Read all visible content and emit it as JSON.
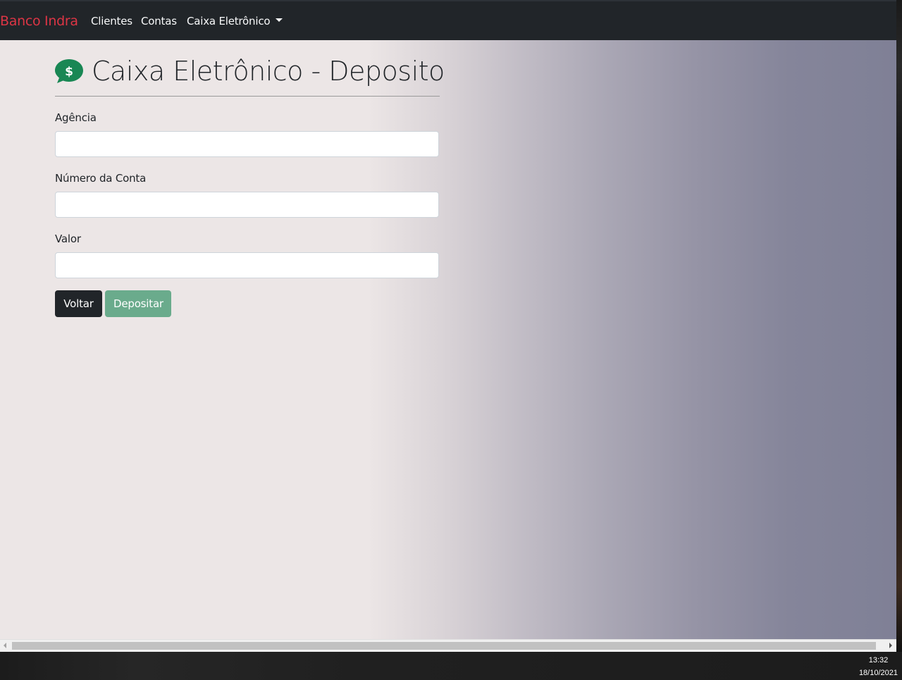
{
  "navbar": {
    "brand": "Banco Indra",
    "links": [
      "Clientes",
      "Contas",
      "Caixa Eletrônico"
    ]
  },
  "page": {
    "title": "Caixa Eletrônico - Deposito",
    "icon": "money-bubble-icon",
    "icon_color": "#198754"
  },
  "form": {
    "agencia_label": "Agência",
    "agencia_value": "",
    "conta_label": "Número da Conta",
    "conta_value": "",
    "valor_label": "Valor",
    "valor_value": ""
  },
  "buttons": {
    "voltar": "Voltar",
    "depositar": "Depositar"
  },
  "taskbar": {
    "time": "13:32",
    "date": "18/10/2021"
  },
  "colors": {
    "brand": "#dc3545",
    "navbar": "#212529",
    "depositar_button": "#6aab8c"
  }
}
